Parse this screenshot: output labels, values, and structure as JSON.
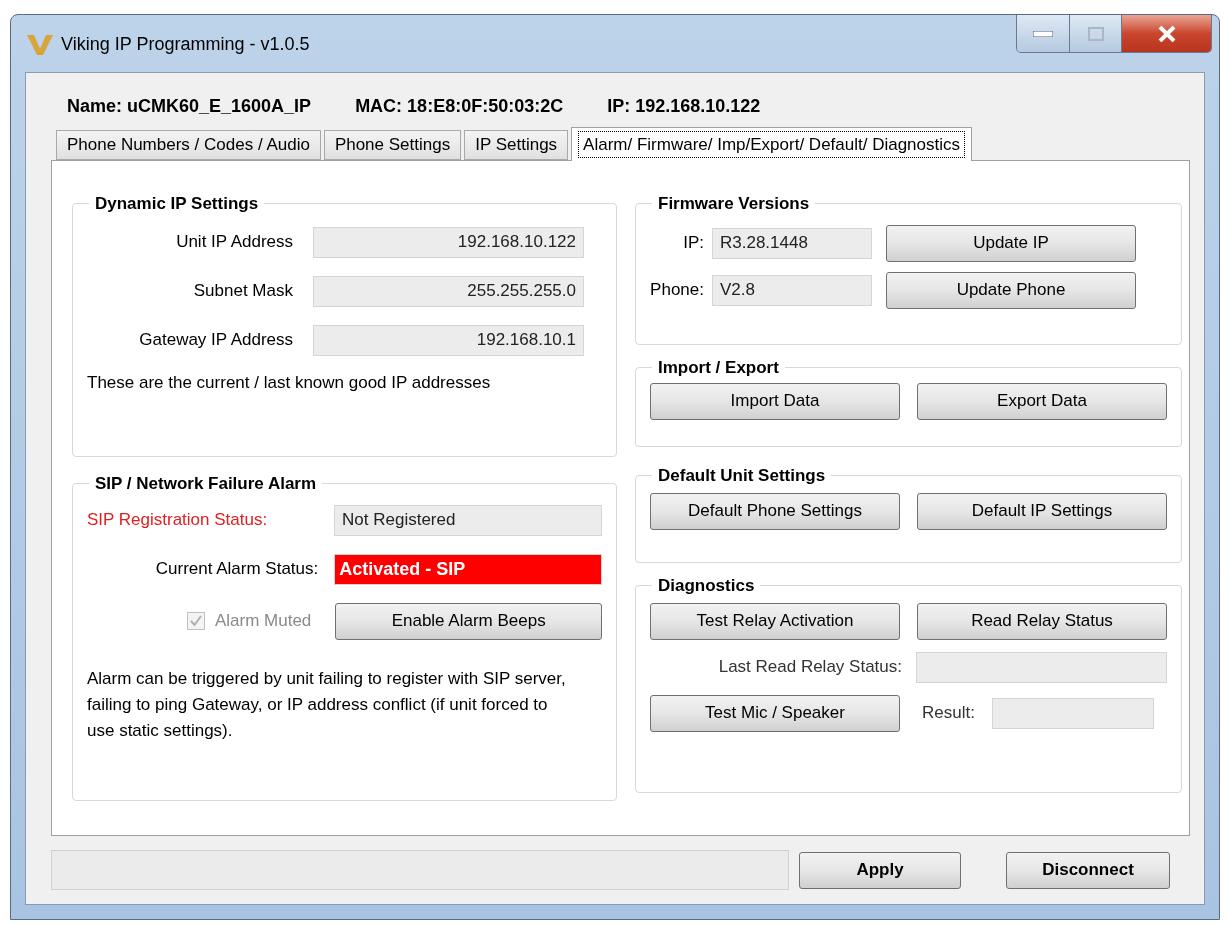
{
  "window": {
    "title": "Viking IP Programming - v1.0.5"
  },
  "header": {
    "name": "Name: uCMK60_E_1600A_IP",
    "mac": "MAC: 18:E8:0F:50:03:2C",
    "ip": "IP: 192.168.10.122"
  },
  "tabs": [
    {
      "label": "Phone Numbers / Codes / Audio",
      "selected": false
    },
    {
      "label": "Phone Settings",
      "selected": false
    },
    {
      "label": "IP Settings",
      "selected": false
    },
    {
      "label": "Alarm/ Firmware/ Imp/Export/ Default/ Diagnostics",
      "selected": true
    }
  ],
  "dynamic_ip": {
    "title": "Dynamic IP Settings",
    "fields": [
      {
        "label": "Unit IP Address",
        "value": "192.168.10.122"
      },
      {
        "label": "Subnet Mask",
        "value": "255.255.255.0"
      },
      {
        "label": "Gateway IP Address",
        "value": "192.168.10.1"
      }
    ],
    "note": "These are the current / last known good IP addresses"
  },
  "sip_alarm": {
    "title": "SIP / Network Failure Alarm",
    "registration": {
      "label": "SIP Registration Status:",
      "value": "Not Registered",
      "alert": true
    },
    "alarm": {
      "label": "Current Alarm Status:",
      "value": "Activated - SIP",
      "active": true
    },
    "muted": {
      "label": "Alarm Muted",
      "checked": true,
      "disabled": true
    },
    "button": "Enable Alarm Beeps",
    "note": "Alarm can be triggered by unit failing to register with SIP server, failing to ping Gateway, or IP address conflict (if unit forced to use static settings)."
  },
  "firmware": {
    "title": "Firmware Versions",
    "rows": [
      {
        "label": "IP:",
        "value": "R3.28.1448",
        "button": "Update IP"
      },
      {
        "label": "Phone:",
        "value": "V2.8",
        "button": "Update Phone"
      }
    ]
  },
  "import_export": {
    "title": "Import / Export",
    "buttons": [
      "Import Data",
      "Export Data"
    ]
  },
  "defaults": {
    "title": "Default Unit Settings",
    "buttons": [
      "Default Phone Settings",
      "Default IP Settings"
    ]
  },
  "diagnostics": {
    "title": "Diagnostics",
    "buttons": [
      "Test Relay Activation",
      "Read Relay Status"
    ],
    "relay_status_label": "Last Read Relay Status:",
    "mic_button": "Test Mic / Speaker",
    "result_label": "Result:"
  },
  "footer": {
    "buttons": [
      "Apply",
      "Disconnect"
    ]
  }
}
